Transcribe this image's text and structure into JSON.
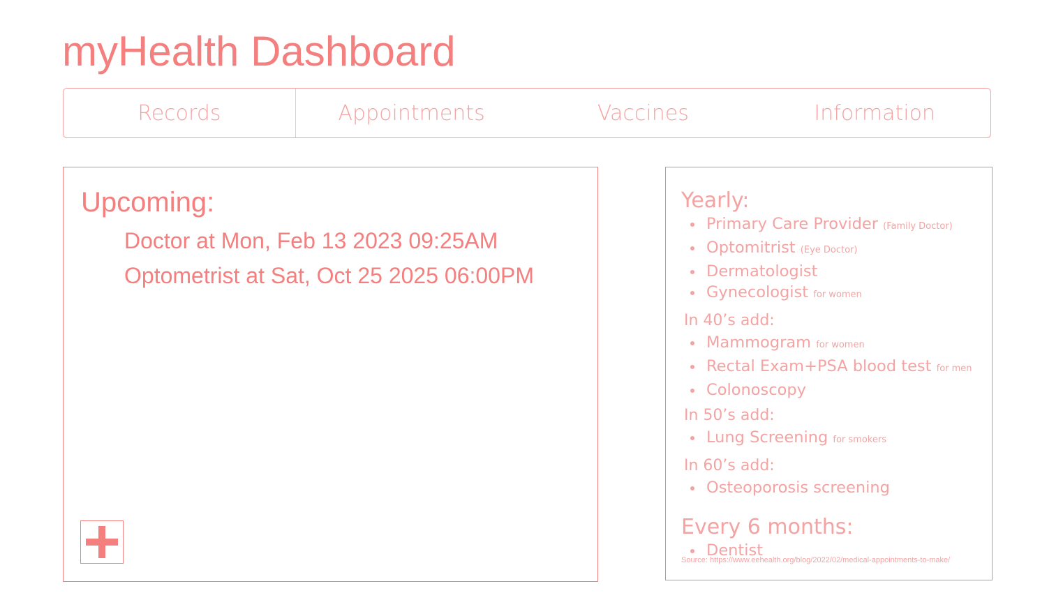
{
  "app": {
    "title": "myHealth Dashboard"
  },
  "nav": {
    "tabs": [
      {
        "label": "Records"
      },
      {
        "label": "Appointments"
      },
      {
        "label": "Vaccines"
      },
      {
        "label": "Information"
      }
    ]
  },
  "upcoming": {
    "heading": "Upcoming:",
    "appointments": [
      "Doctor at Mon, Feb 13 2023 09:25AM",
      "Optometrist at Sat, Oct 25 2025 06:00PM"
    ],
    "add_button_icon": "plus-icon"
  },
  "info": {
    "yearly": {
      "heading": "Yearly:",
      "items": [
        {
          "label": "Primary Care Provider",
          "note": "(Family Doctor)"
        },
        {
          "label": "Optomitrist",
          "note": "(Eye Doctor)"
        },
        {
          "label": "Dermatologist",
          "note": ""
        },
        {
          "label": "Gynecologist",
          "note": "for women"
        }
      ]
    },
    "forties": {
      "heading": "In 40’s add:",
      "items": [
        {
          "label": "Mammogram",
          "note": "for women"
        },
        {
          "label": "Rectal Exam+PSA blood test",
          "note": "for men"
        },
        {
          "label": "Colonoscopy",
          "note": ""
        }
      ]
    },
    "fifties": {
      "heading": "In 50’s add:",
      "items": [
        {
          "label": "Lung Screening",
          "note": "for smokers"
        }
      ]
    },
    "sixties": {
      "heading": "In 60’s add:",
      "items": [
        {
          "label": "Osteoporosis screening",
          "note": ""
        }
      ]
    },
    "six_months": {
      "heading": "Every 6 months:",
      "items": [
        {
          "label": "Dentist",
          "note": ""
        }
      ]
    },
    "source": "Source: https://www.eehealth.org/blog/2022/02/medical-appointments-to-make/"
  },
  "colors": {
    "accent": "#f47f7f",
    "accent_light": "#f4a3a3"
  }
}
